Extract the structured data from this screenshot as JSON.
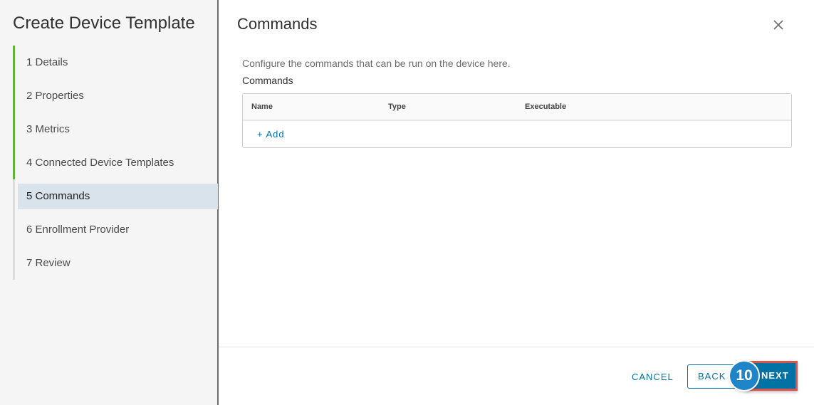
{
  "wizard": {
    "title": "Create Device Template",
    "steps": [
      {
        "label": "1 Details",
        "state": "done"
      },
      {
        "label": "2 Properties",
        "state": "done"
      },
      {
        "label": "3 Metrics",
        "state": "done"
      },
      {
        "label": "4 Connected Device Templates",
        "state": "done"
      },
      {
        "label": "5 Commands",
        "state": "current"
      },
      {
        "label": "6 Enrollment Provider",
        "state": "todo"
      },
      {
        "label": "7 Review",
        "state": "todo"
      }
    ]
  },
  "dialog": {
    "title": "Commands",
    "description": "Configure the commands that can be run on the device here.",
    "section_label": "Commands",
    "close_icon": "close-icon"
  },
  "grid": {
    "columns": [
      "Name",
      "Type",
      "Executable"
    ],
    "add_label": "+ Add"
  },
  "footer": {
    "cancel_label": "CANCEL",
    "back_label": "BACK",
    "next_label": "NEXT",
    "step_badge": "10"
  },
  "colors": {
    "accent": "#0072a3",
    "done_step": "#62b23c",
    "current_step_bg": "#d8e3eb",
    "highlight_border": "#e0534b",
    "badge": "#1f84c8"
  }
}
